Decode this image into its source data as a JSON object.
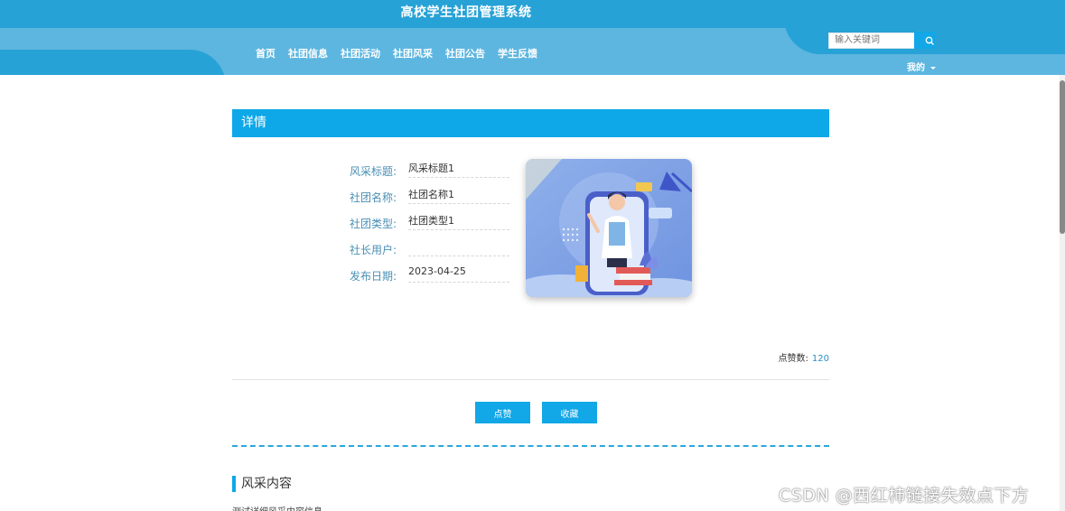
{
  "header": {
    "site_title": "高校学生社团管理系统",
    "nav": [
      "首页",
      "社团信息",
      "社团活动",
      "社团风采",
      "社团公告",
      "学生反馈"
    ],
    "search_placeholder": "输入关键词",
    "user_menu_label": "我的"
  },
  "detail": {
    "title": "详情",
    "fields": [
      {
        "label": "风采标题:",
        "value": "风采标题1"
      },
      {
        "label": "社团名称:",
        "value": "社团名称1"
      },
      {
        "label": "社团类型:",
        "value": "社团类型1"
      },
      {
        "label": "社长用户:",
        "value": ""
      },
      {
        "label": "发布日期:",
        "value": "2023-04-25"
      }
    ],
    "likes_label": "点赞数:",
    "likes_count": "120",
    "like_button": "点赞",
    "favorite_button": "收藏"
  },
  "content_section": {
    "title": "风采内容",
    "text": "测试详细风采内容信息"
  },
  "watermark": "CSDN @西红柿链接失效点下方",
  "colors": {
    "header_dark": "#27a2d6",
    "header_light": "#5db6e0",
    "accent": "#0ea8e8",
    "label": "#4a8fb4"
  }
}
